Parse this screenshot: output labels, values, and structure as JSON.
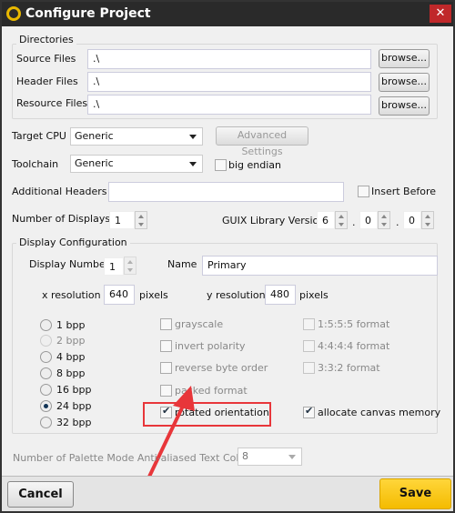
{
  "window": {
    "title": "Configure Project",
    "close": "✕"
  },
  "directories": {
    "label": "Directories",
    "rows": [
      {
        "label": "Source Files",
        "value": ".\\",
        "browse": "browse..."
      },
      {
        "label": "Header Files",
        "value": ".\\",
        "browse": "browse..."
      },
      {
        "label": "Resource Files",
        "value": ".\\",
        "browse": "browse..."
      }
    ]
  },
  "target_cpu": {
    "label": "Target CPU",
    "value": "Generic",
    "advanced": "Advanced Settings"
  },
  "toolchain": {
    "label": "Toolchain",
    "value": "Generic",
    "big_endian": "big endian",
    "big_endian_checked": false
  },
  "additional_headers": {
    "label": "Additional Headers",
    "value": "",
    "insert_before": "Insert Before",
    "insert_before_checked": false
  },
  "num_displays": {
    "label": "Number of Displays",
    "value": "1"
  },
  "guix_version": {
    "label": "GUIX Library Version",
    "major": "6",
    "minor": "0",
    "patch": "0",
    "sep": "."
  },
  "display": {
    "label": "Display Configuration",
    "number_label": "Display Number",
    "number": "1",
    "name_label": "Name",
    "name": "Primary",
    "xres_label": "x resolution",
    "xres": "640",
    "yres_label": "y resolution",
    "yres": "480",
    "unit": "pixels",
    "bpp": [
      {
        "label": "1 bpp"
      },
      {
        "label": "2 bpp",
        "disabled": true
      },
      {
        "label": "4 bpp"
      },
      {
        "label": "8 bpp"
      },
      {
        "label": "16 bpp"
      },
      {
        "label": "24 bpp",
        "selected": true
      },
      {
        "label": "32 bpp"
      }
    ],
    "options": [
      {
        "label": "grayscale",
        "checked": false
      },
      {
        "label": "invert polarity",
        "checked": false
      },
      {
        "label": "reverse byte order",
        "checked": false
      },
      {
        "label": "packed format",
        "checked": false
      },
      {
        "label": "rotated orientation",
        "checked": true
      }
    ],
    "formats": [
      {
        "label": "1:5:5:5 format"
      },
      {
        "label": "4:4:4:4 format"
      },
      {
        "label": "3:3:2 format"
      }
    ],
    "allocate": {
      "label": "allocate canvas memory",
      "checked": true
    }
  },
  "palette": {
    "label": "Number of Palette Mode Anti-aliased Text Colors:",
    "value": "8"
  },
  "footer": {
    "cancel": "Cancel",
    "save": "Save"
  },
  "colors": {
    "highlight": "#e8363a",
    "save": "#f8c400"
  }
}
